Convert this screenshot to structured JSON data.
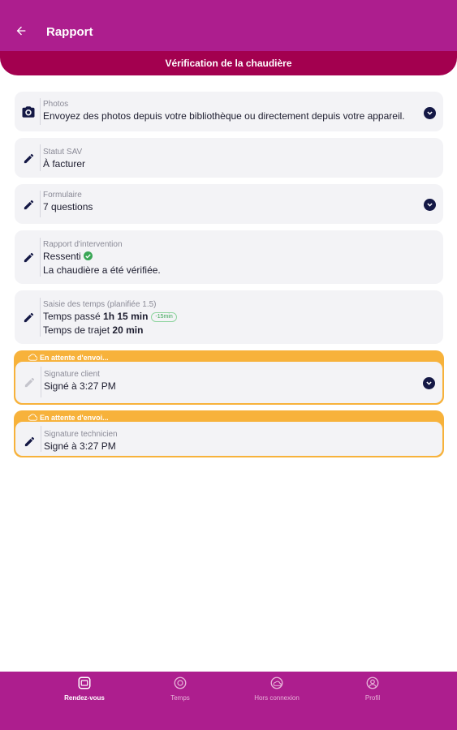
{
  "header": {
    "title": "Rapport",
    "subtitle": "Vérification de la chaudière"
  },
  "colors": {
    "brand": "#ad1e8e",
    "brand_dark": "#a3004f",
    "pending": "#f7b23b",
    "ok": "#3aa656"
  },
  "cards": {
    "photos": {
      "label": "Photos",
      "value": "Envoyez des photos depuis votre bibliothèque ou directement depuis votre appareil."
    },
    "statut": {
      "label": "Statut SAV",
      "value": "À facturer"
    },
    "formulaire": {
      "label": "Formulaire",
      "value": "7 questions"
    },
    "rapport": {
      "label": "Rapport d'intervention",
      "ressenti": "Ressenti",
      "text": "La chaudière a été vérifiée."
    },
    "temps": {
      "label": "Saisie des temps (planifiée 1.5)",
      "passe_prefix": "Temps passé",
      "passe_value": "1h 15 min",
      "passe_tag": "-15min",
      "trajet_prefix": "Temps de trajet",
      "trajet_value": "20 min"
    }
  },
  "pending": {
    "status": "En attente d'envoi...",
    "client": {
      "label": "Signature client",
      "value": "Signé à 3:27 PM"
    },
    "technicien": {
      "label": "Signature technicien",
      "value": "Signé à 3:27 PM"
    }
  },
  "nav": {
    "items": [
      {
        "label": "Rendez-vous",
        "icon": "calendar-icon",
        "active": true
      },
      {
        "label": "Temps",
        "icon": "clock-icon",
        "active": false
      },
      {
        "label": "Hors connexion",
        "icon": "offline-icon",
        "active": false
      },
      {
        "label": "Profil",
        "icon": "profile-icon",
        "active": false
      }
    ]
  }
}
